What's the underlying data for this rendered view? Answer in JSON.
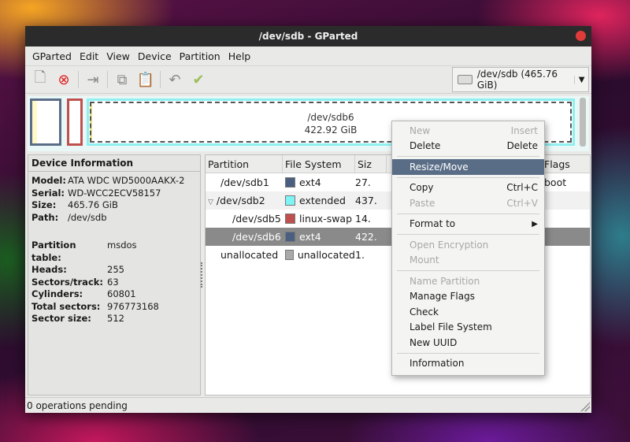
{
  "window": {
    "title": "/dev/sdb - GParted"
  },
  "menubar": {
    "items": [
      "GParted",
      "Edit",
      "View",
      "Device",
      "Partition",
      "Help"
    ]
  },
  "toolbar": {
    "icons": [
      "new-icon",
      "delete-icon",
      "resize-icon",
      "copy-icon",
      "paste-icon",
      "undo-icon",
      "apply-icon"
    ]
  },
  "device_selector": {
    "label": "/dev/sdb  (465.76 GiB)"
  },
  "diskmap": {
    "selected_name": "/dev/sdb6",
    "selected_size": "422.92 GiB"
  },
  "device_info": {
    "heading": "Device Information",
    "rows": [
      {
        "k": "Model:",
        "v": "ATA WDC WD5000AAKX-2"
      },
      {
        "k": "Serial:",
        "v": "WD-WCC2ECV58157"
      },
      {
        "k": "Size:",
        "v": "465.76 GiB"
      },
      {
        "k": "Path:",
        "v": "/dev/sdb"
      }
    ],
    "rows2": [
      {
        "k": "Partition table:",
        "v": "msdos"
      },
      {
        "k": "Heads:",
        "v": "255"
      },
      {
        "k": "Sectors/track:",
        "v": "63"
      },
      {
        "k": "Cylinders:",
        "v": "60801"
      },
      {
        "k": "Total sectors:",
        "v": "976773168"
      },
      {
        "k": "Sector size:",
        "v": "512"
      }
    ]
  },
  "table": {
    "headers": [
      "Partition",
      "File System",
      "Siz",
      "Flags"
    ],
    "rows": [
      {
        "partition": "/dev/sdb1",
        "fs": "ext4",
        "size": "27.",
        "flags": "boot",
        "color": "#4a5f80"
      },
      {
        "partition": "/dev/sdb2",
        "fs": "extended",
        "size": "437.",
        "flags": "",
        "color": "#7ff4f4"
      },
      {
        "partition": "/dev/sdb5",
        "fs": "linux-swap",
        "size": "14.",
        "flags": "",
        "color": "#c0504d"
      },
      {
        "partition": "/dev/sdb6",
        "fs": "ext4",
        "size": "422.",
        "flags": "",
        "color": "#4a5f80"
      },
      {
        "partition": "unallocated",
        "fs": "unallocated",
        "size": "1.",
        "flags": "",
        "color": "#a9a9a9"
      }
    ]
  },
  "context_menu": {
    "new": "New",
    "new_acc": "Insert",
    "delete": "Delete",
    "delete_acc": "Delete",
    "resize": "Resize/Move",
    "copy": "Copy",
    "copy_acc": "Ctrl+C",
    "paste": "Paste",
    "paste_acc": "Ctrl+V",
    "format": "Format to",
    "open_enc": "Open Encryption",
    "mount": "Mount",
    "name_part": "Name Partition",
    "manage_flags": "Manage Flags",
    "check": "Check",
    "label_fs": "Label File System",
    "new_uuid": "New UUID",
    "information": "Information"
  },
  "status": {
    "text": "0 operations pending"
  }
}
